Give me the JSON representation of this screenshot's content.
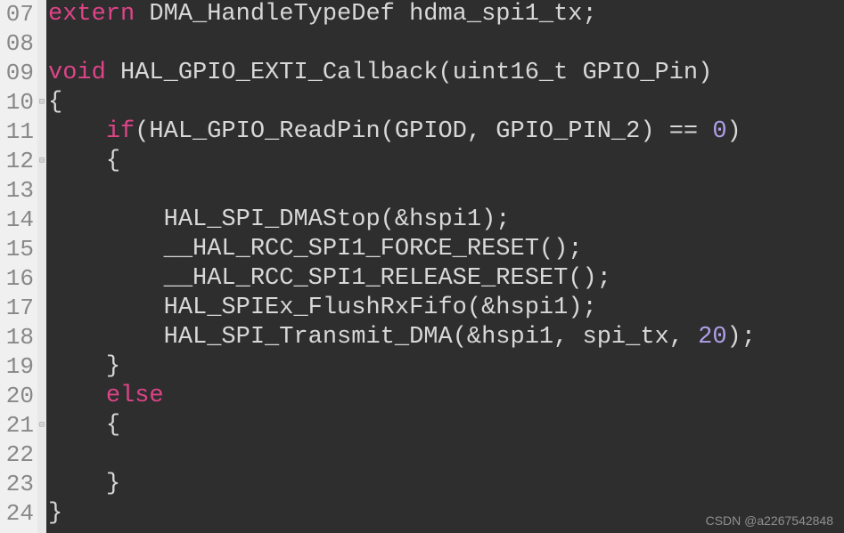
{
  "lines": [
    {
      "n": "07",
      "fold": "",
      "tokens": [
        {
          "cls": "kw-extern",
          "t": "extern"
        },
        {
          "cls": "txt",
          "t": " "
        },
        {
          "cls": "type",
          "t": "DMA_HandleTypeDef"
        },
        {
          "cls": "txt",
          "t": " "
        },
        {
          "cls": "ident",
          "t": "hdma_spi1_tx"
        },
        {
          "cls": "semi",
          "t": ";"
        }
      ]
    },
    {
      "n": "08",
      "fold": "",
      "tokens": []
    },
    {
      "n": "09",
      "fold": "",
      "tokens": [
        {
          "cls": "kw-void",
          "t": "void"
        },
        {
          "cls": "txt",
          "t": " "
        },
        {
          "cls": "func",
          "t": "HAL_GPIO_EXTI_Callback"
        },
        {
          "cls": "paren",
          "t": "("
        },
        {
          "cls": "type",
          "t": "uint16_t"
        },
        {
          "cls": "txt",
          "t": " "
        },
        {
          "cls": "ident",
          "t": "GPIO_Pin"
        },
        {
          "cls": "paren",
          "t": ")"
        }
      ]
    },
    {
      "n": "10",
      "fold": "⊟",
      "tokens": [
        {
          "cls": "brace",
          "t": "{"
        }
      ]
    },
    {
      "n": "11",
      "fold": "",
      "tokens": [
        {
          "cls": "txt",
          "t": "    "
        },
        {
          "cls": "kw-if",
          "t": "if"
        },
        {
          "cls": "paren",
          "t": "("
        },
        {
          "cls": "func",
          "t": "HAL_GPIO_ReadPin"
        },
        {
          "cls": "paren",
          "t": "("
        },
        {
          "cls": "ident",
          "t": "GPIOD"
        },
        {
          "cls": "comma",
          "t": ","
        },
        {
          "cls": "txt",
          "t": " "
        },
        {
          "cls": "ident",
          "t": "GPIO_PIN_2"
        },
        {
          "cls": "paren",
          "t": ")"
        },
        {
          "cls": "txt",
          "t": " "
        },
        {
          "cls": "op",
          "t": "=="
        },
        {
          "cls": "txt",
          "t": " "
        },
        {
          "cls": "num",
          "t": "0"
        },
        {
          "cls": "paren",
          "t": ")"
        }
      ]
    },
    {
      "n": "12",
      "fold": "⊟",
      "tokens": [
        {
          "cls": "txt",
          "t": "    "
        },
        {
          "cls": "brace",
          "t": "{"
        }
      ]
    },
    {
      "n": "13",
      "fold": "",
      "tokens": []
    },
    {
      "n": "14",
      "fold": "",
      "tokens": [
        {
          "cls": "txt",
          "t": "        "
        },
        {
          "cls": "func",
          "t": "HAL_SPI_DMAStop"
        },
        {
          "cls": "paren",
          "t": "("
        },
        {
          "cls": "op",
          "t": "&"
        },
        {
          "cls": "ident",
          "t": "hspi1"
        },
        {
          "cls": "paren",
          "t": ")"
        },
        {
          "cls": "semi",
          "t": ";"
        }
      ]
    },
    {
      "n": "15",
      "fold": "",
      "tokens": [
        {
          "cls": "txt",
          "t": "        "
        },
        {
          "cls": "func",
          "t": "__HAL_RCC_SPI1_FORCE_RESET"
        },
        {
          "cls": "paren",
          "t": "("
        },
        {
          "cls": "paren",
          "t": ")"
        },
        {
          "cls": "semi",
          "t": ";"
        }
      ]
    },
    {
      "n": "16",
      "fold": "",
      "tokens": [
        {
          "cls": "txt",
          "t": "        "
        },
        {
          "cls": "func",
          "t": "__HAL_RCC_SPI1_RELEASE_RESET"
        },
        {
          "cls": "paren",
          "t": "("
        },
        {
          "cls": "paren",
          "t": ")"
        },
        {
          "cls": "semi",
          "t": ";"
        }
      ]
    },
    {
      "n": "17",
      "fold": "",
      "tokens": [
        {
          "cls": "txt",
          "t": "        "
        },
        {
          "cls": "func",
          "t": "HAL_SPIEx_FlushRxFifo"
        },
        {
          "cls": "paren",
          "t": "("
        },
        {
          "cls": "op",
          "t": "&"
        },
        {
          "cls": "ident",
          "t": "hspi1"
        },
        {
          "cls": "paren",
          "t": ")"
        },
        {
          "cls": "semi",
          "t": ";"
        }
      ]
    },
    {
      "n": "18",
      "fold": "",
      "tokens": [
        {
          "cls": "txt",
          "t": "        "
        },
        {
          "cls": "func",
          "t": "HAL_SPI_Transmit_DMA"
        },
        {
          "cls": "paren",
          "t": "("
        },
        {
          "cls": "op",
          "t": "&"
        },
        {
          "cls": "ident",
          "t": "hspi1"
        },
        {
          "cls": "comma",
          "t": ","
        },
        {
          "cls": "txt",
          "t": " "
        },
        {
          "cls": "ident",
          "t": "spi_tx"
        },
        {
          "cls": "comma",
          "t": ","
        },
        {
          "cls": "txt",
          "t": " "
        },
        {
          "cls": "num",
          "t": "20"
        },
        {
          "cls": "paren",
          "t": ")"
        },
        {
          "cls": "semi",
          "t": ";"
        }
      ]
    },
    {
      "n": "19",
      "fold": "",
      "tokens": [
        {
          "cls": "txt",
          "t": "    "
        },
        {
          "cls": "brace",
          "t": "}"
        }
      ]
    },
    {
      "n": "20",
      "fold": "",
      "tokens": [
        {
          "cls": "txt",
          "t": "    "
        },
        {
          "cls": "kw-else",
          "t": "else"
        }
      ]
    },
    {
      "n": "21",
      "fold": "⊟",
      "tokens": [
        {
          "cls": "txt",
          "t": "    "
        },
        {
          "cls": "brace",
          "t": "{"
        }
      ]
    },
    {
      "n": "22",
      "fold": "",
      "tokens": []
    },
    {
      "n": "23",
      "fold": "",
      "tokens": [
        {
          "cls": "txt",
          "t": "    "
        },
        {
          "cls": "brace",
          "t": "}"
        }
      ]
    },
    {
      "n": "24",
      "fold": "",
      "tokens": [
        {
          "cls": "brace",
          "t": "}"
        }
      ]
    }
  ],
  "watermark": "CSDN @a2267542848"
}
